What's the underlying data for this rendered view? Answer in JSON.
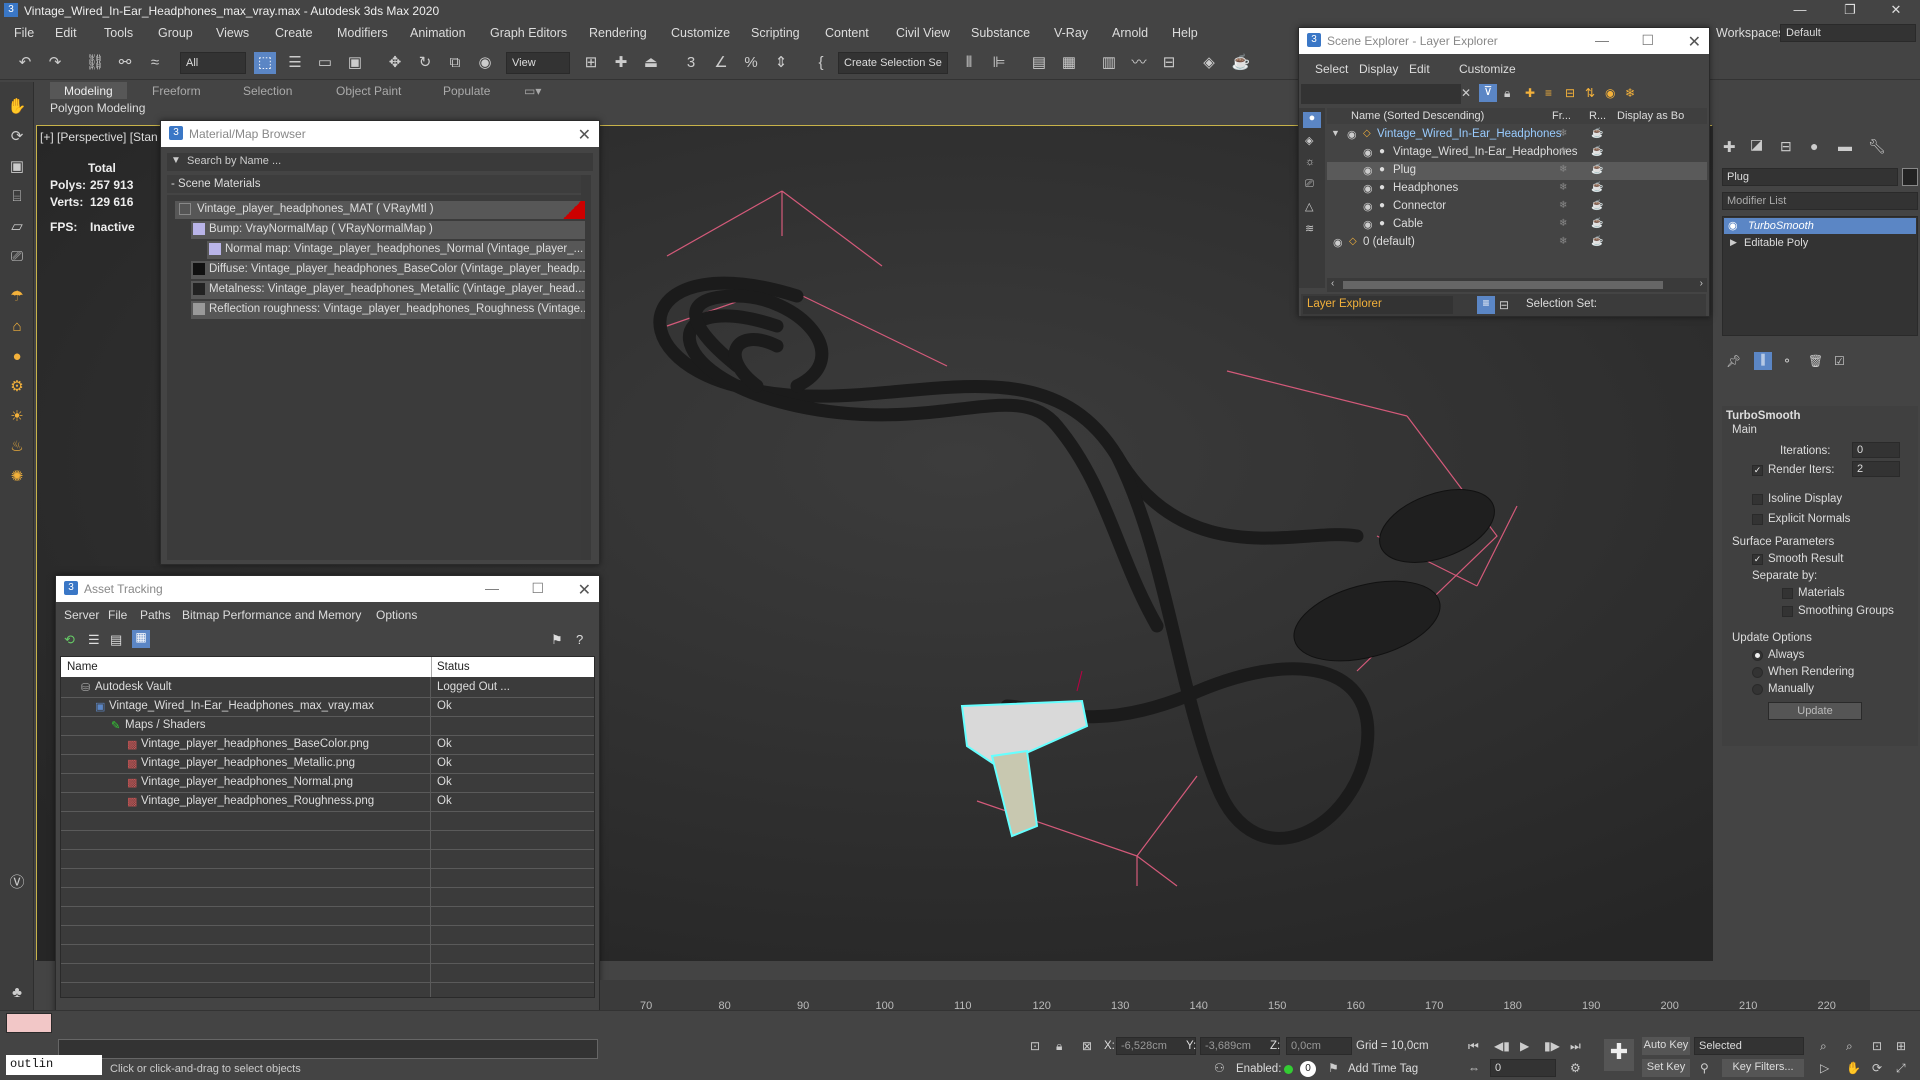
{
  "window": {
    "title": "Vintage_Wired_In-Ear_Headphones_max_vray.max - Autodesk 3ds Max 2020",
    "workspaces_label": "Workspaces:",
    "workspace_value": "Default"
  },
  "menubar": [
    "File",
    "Edit",
    "Tools",
    "Group",
    "Views",
    "Create",
    "Modifiers",
    "Animation",
    "Graph Editors",
    "Rendering",
    "Customize",
    "Scripting",
    "Content",
    "Civil View",
    "Substance",
    "V-Ray",
    "Arnold",
    "Help"
  ],
  "toolbar": {
    "filter_value": "All",
    "view_value": "View",
    "selection_set_value": "Create Selection Se"
  },
  "ribbon": {
    "tabs": [
      "Modeling",
      "Freeform",
      "Selection",
      "Object Paint",
      "Populate"
    ],
    "subtab": "Polygon Modeling"
  },
  "viewport": {
    "label": "[+] [Perspective] [Stan",
    "stats_total": "Total",
    "polys_label": "Polys:",
    "polys_value": "257 913",
    "verts_label": "Verts:",
    "verts_value": "129 616",
    "fps_label": "FPS:",
    "fps_value": "Inactive"
  },
  "material_browser": {
    "title": "Material/Map Browser",
    "search_placeholder": "Search by Name ...",
    "section": "- Scene Materials",
    "items": [
      "Vintage_player_headphones_MAT ( VRayMtl )",
      "Bump: VrayNormalMap ( VRayNormalMap )",
      "Normal map: Vintage_player_headphones_Normal (Vintage_player_...",
      "Diffuse: Vintage_player_headphones_BaseColor (Vintage_player_headp...",
      "Metalness: Vintage_player_headphones_Metallic (Vintage_player_head...",
      "Reflection roughness: Vintage_player_headphones_Roughness (Vintage..."
    ]
  },
  "asset_tracking": {
    "title": "Asset Tracking",
    "menu": [
      "Server",
      "File",
      "Paths",
      "Bitmap Performance and Memory",
      "Options"
    ],
    "col_name": "Name",
    "col_status": "Status",
    "rows": [
      {
        "name": "Autodesk Vault",
        "status": "Logged Out ..."
      },
      {
        "name": "Vintage_Wired_In-Ear_Headphones_max_vray.max",
        "status": "Ok"
      },
      {
        "name": "Maps / Shaders",
        "status": ""
      },
      {
        "name": "Vintage_player_headphones_BaseColor.png",
        "status": "Ok"
      },
      {
        "name": "Vintage_player_headphones_Metallic.png",
        "status": "Ok"
      },
      {
        "name": "Vintage_player_headphones_Normal.png",
        "status": "Ok"
      },
      {
        "name": "Vintage_player_headphones_Roughness.png",
        "status": "Ok"
      }
    ]
  },
  "scene_explorer": {
    "title": "Scene Explorer - Layer Explorer",
    "menu": [
      "Select",
      "Display",
      "Edit",
      "Customize"
    ],
    "col_name": "Name (Sorted Descending)",
    "col_fr": "Fr...",
    "col_r": "R...",
    "col_display": "Display as Bo",
    "rows": [
      "Vintage_Wired_In-Ear_Headphones",
      "Vintage_Wired_In-Ear_Headphones",
      "Plug",
      "Headphones",
      "Connector",
      "Cable",
      "0 (default)"
    ],
    "footer_layer": "Layer Explorer",
    "footer_selset": "Selection Set:"
  },
  "command_panel": {
    "object_name": "Plug",
    "modifier_list": "Modifier List",
    "stack": [
      "TurboSmooth",
      "Editable Poly"
    ],
    "rollout_title": "TurboSmooth",
    "main_label": "Main",
    "iterations_label": "Iterations:",
    "iterations_value": "0",
    "render_iters_label": "Render Iters:",
    "render_iters_value": "2",
    "isoline": "Isoline Display",
    "explicit": "Explicit Normals",
    "surface_params": "Surface Parameters",
    "smooth_result": "Smooth Result",
    "separate_by": "Separate by:",
    "materials": "Materials",
    "smoothing_groups": "Smoothing Groups",
    "update_options": "Update Options",
    "always": "Always",
    "when_rendering": "When Rendering",
    "manually": "Manually",
    "update_button": "Update"
  },
  "timeline": {
    "ticks": [
      "70",
      "80",
      "90",
      "100",
      "110",
      "120",
      "130",
      "140",
      "150",
      "160",
      "170",
      "180",
      "190",
      "200",
      "210",
      "220"
    ]
  },
  "statusbar": {
    "maxscript": "outlin",
    "prompt": "Click or click-and-drag to select objects",
    "x_label": "X:",
    "x_value": "-6,528cm",
    "y_label": "Y:",
    "y_value": "-3,689cm",
    "z_label": "Z:",
    "z_value": "0,0cm",
    "grid": "Grid = 10,0cm",
    "enabled": "Enabled:",
    "add_time_tag": "Add Time Tag",
    "auto_key": "Auto Key",
    "set_key": "Set Key",
    "selected": "Selected",
    "key_filters": "Key Filters...",
    "frame": "0"
  }
}
